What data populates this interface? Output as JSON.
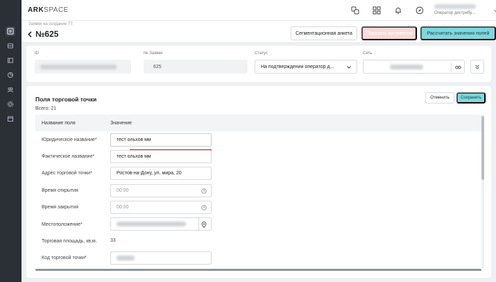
{
  "app": {
    "logo_main": "ARK",
    "logo_accent": "SPACE"
  },
  "user": {
    "role": "Оператор дистрибу..."
  },
  "header": {
    "breadcrumb": "Заявки на создание ТТ",
    "title": "№625",
    "buttons": {
      "segment": "Сегментационная анкета",
      "disabled": "Показать аргументы",
      "calculate": "Рассчитать значения полей"
    }
  },
  "filters": {
    "id_label": "ID",
    "request_label": "№ Заявки",
    "request_value": "625",
    "status_label": "Статус",
    "status_value": "На подтверждении оператор д...",
    "network_label": "Сеть"
  },
  "main": {
    "title": "Поля торговой точки",
    "total": "Всего: 21",
    "cancel": "Отменить",
    "save": "Сохранить",
    "col_name": "Название поля",
    "col_value": "Значение",
    "rows": [
      {
        "label": "Юридическое название*",
        "value": "тест ольхов мм"
      },
      {
        "label": "Фактическое название*",
        "value": "тест ольхов мм"
      },
      {
        "label": "Адрес торговой точки*",
        "value": "Ростов-на-Дону, ул. мира, 20"
      },
      {
        "label": "Время открытия",
        "placeholder": "00:00"
      },
      {
        "label": "Время закрытия",
        "placeholder": "00:00"
      },
      {
        "label": "Местоположение*",
        "value": ""
      },
      {
        "label": "Торговая площадь, кв.м.",
        "value": "33"
      },
      {
        "label": "Код торговой точки*",
        "value": ""
      }
    ]
  },
  "colors": {
    "accent": "#7dd9df",
    "sidebar": "#2b2f36",
    "error": "#e02020",
    "disabled": "#f9d8d8"
  }
}
